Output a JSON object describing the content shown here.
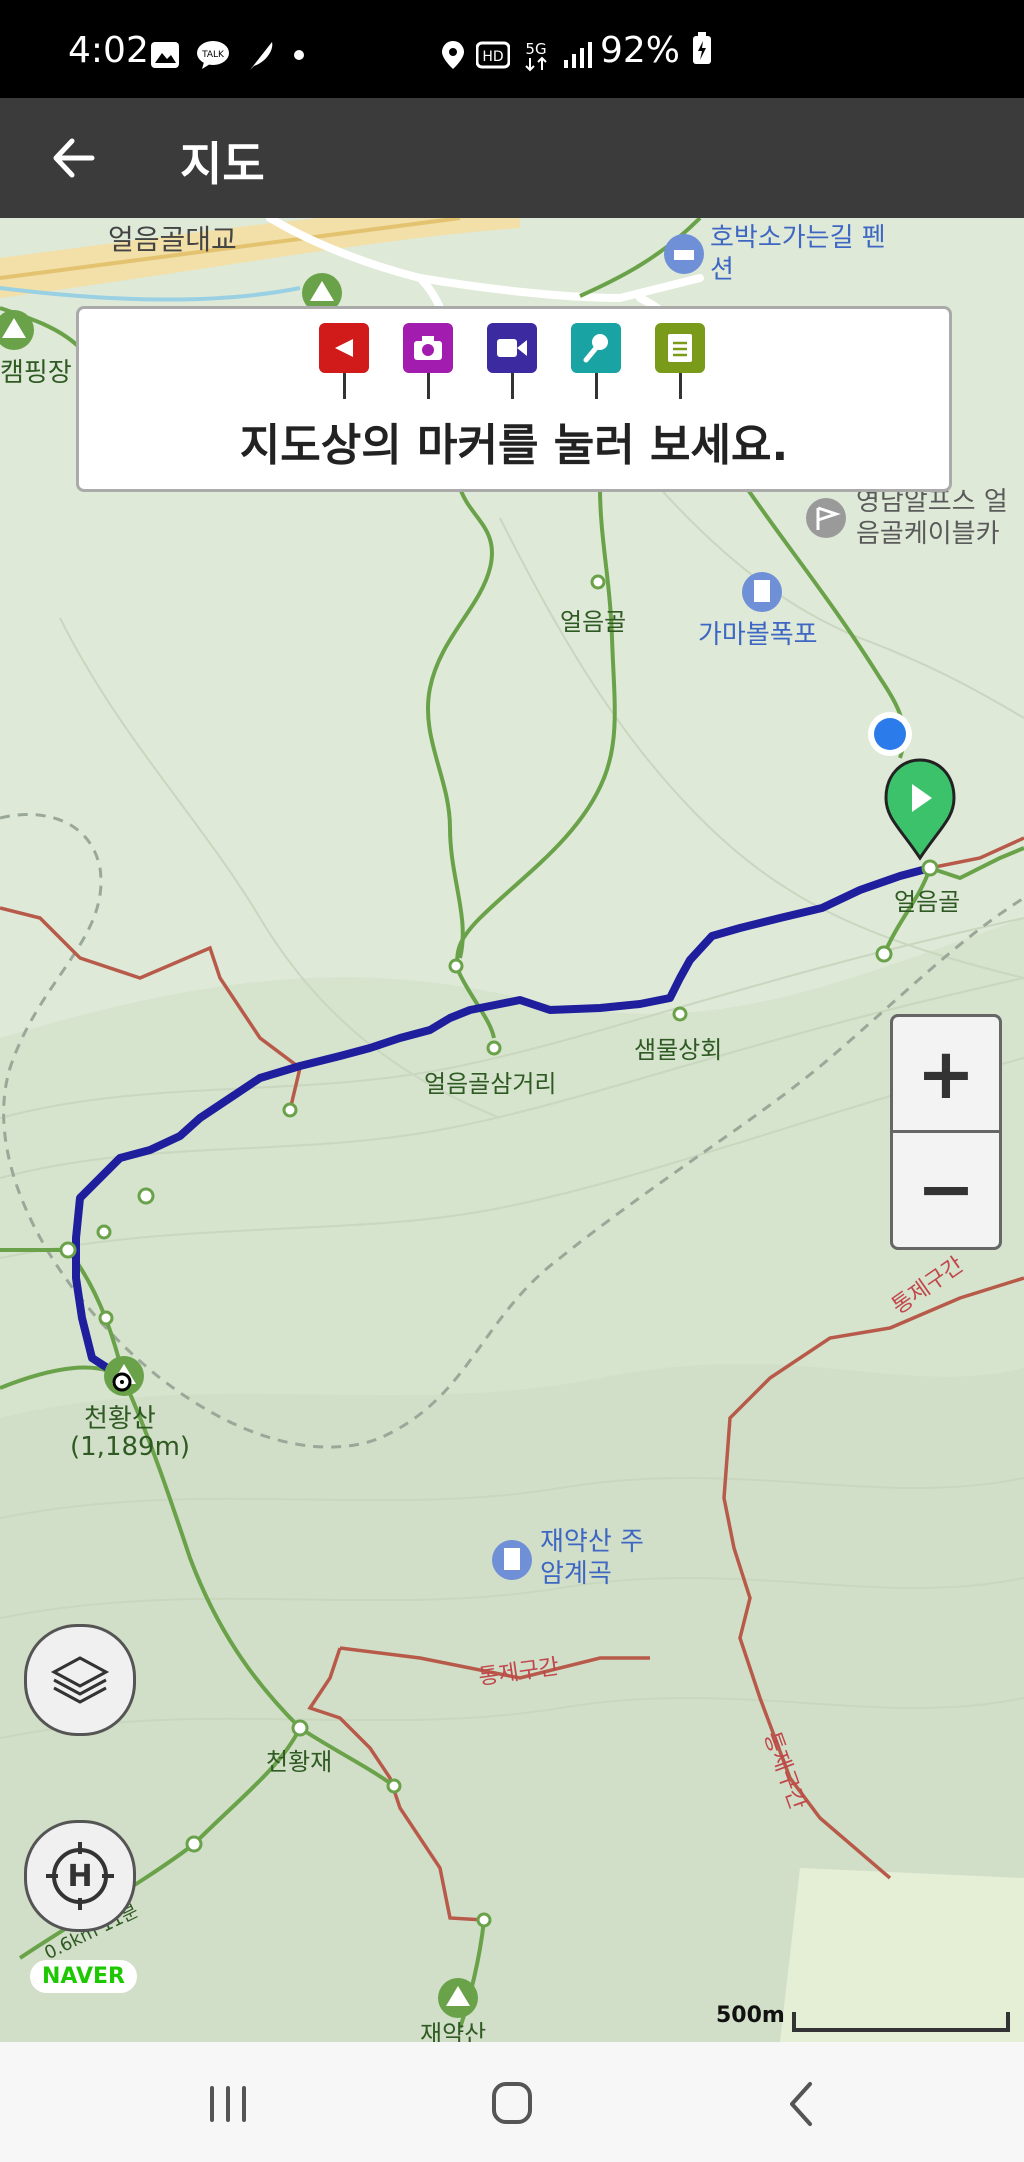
{
  "status": {
    "time": "4:02",
    "battery": "92%",
    "icons_left": [
      "gallery-icon",
      "kakaotalk-icon",
      "feather-icon",
      "dot-icon"
    ],
    "icons_mid": [
      "location-icon",
      "hd-icon",
      "5g-icon",
      "signal-icon"
    ]
  },
  "appbar": {
    "title": "지도"
  },
  "legend": {
    "message": "지도상의 마커를 눌러 보세요.",
    "markers": [
      {
        "name": "flag-marker",
        "color": "#d11b1b"
      },
      {
        "name": "camera-marker",
        "color": "#a21caf"
      },
      {
        "name": "video-marker",
        "color": "#3b2aa0"
      },
      {
        "name": "microphone-marker",
        "color": "#1aa3a3"
      },
      {
        "name": "memo-marker",
        "color": "#7a9a1a"
      }
    ]
  },
  "map": {
    "labels": {
      "bridge": "얼음골대교",
      "pension": "호박소가는길 펜션",
      "camping": "캠핑장",
      "cablecar": "영남알프스 얼음골케이블카",
      "eoleumgol_top": "얼음골",
      "falls": "가마볼폭포",
      "eoleumgol_right": "얼음골",
      "spring": "샘물상회",
      "junction": "얼음골삼거리",
      "cheonhwang": "천황산",
      "cheonhwang_height": "(1,189m)",
      "jaeyak_valley": "재약산 주암계곡",
      "restricted1": "통제구간",
      "restricted2": "통제구간",
      "restricted3": "통제구간",
      "cheonhwangjae": "천황재",
      "trail_distance": "0.6km·11분",
      "jaeyaksan": "재약산"
    },
    "colors": {
      "route": "#1f1f9e",
      "trail": "#6aa24a",
      "boundary": "#b75a4a",
      "current_location": "#2b7bea",
      "start_marker": "#3cc26b"
    }
  },
  "zoom": {
    "plus": "+",
    "minus": "−"
  },
  "brand": "NAVER",
  "scale_label": "500m"
}
